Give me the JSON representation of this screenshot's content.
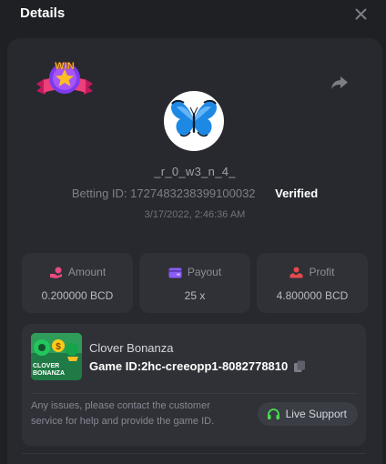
{
  "header": {
    "title": "Details"
  },
  "player": {
    "username": "_r_0_w3_n_4_",
    "betting_id_label": "Betting ID:",
    "betting_id": "1727483238399100032",
    "status": "Verified",
    "timestamp": "3/17/2022, 2:46:36 AM"
  },
  "badge": {
    "text": "WIN"
  },
  "stats": [
    {
      "label": "Amount",
      "value": "0.200000 BCD",
      "icon": "amount-icon"
    },
    {
      "label": "Payout",
      "value": "25 x",
      "icon": "wallet-icon"
    },
    {
      "label": "Profit",
      "value": "4.800000 BCD",
      "icon": "profit-icon"
    }
  ],
  "game": {
    "name": "Clover Bonanza",
    "thumb_line1": "CLOVER",
    "thumb_line2": "BONANZA",
    "id_label": "Game ID:",
    "id": "2hc-creeopp1-8082778810"
  },
  "support": {
    "message": "Any issues, please contact the customer service for help and provide the game ID.",
    "button_label": "Live Support"
  },
  "colors": {
    "accent_pink": "#e84a7f",
    "accent_purple": "#8b5cf6",
    "accent_red": "#e5484d",
    "accent_green": "#4ade50",
    "verified": "#ffffff"
  }
}
